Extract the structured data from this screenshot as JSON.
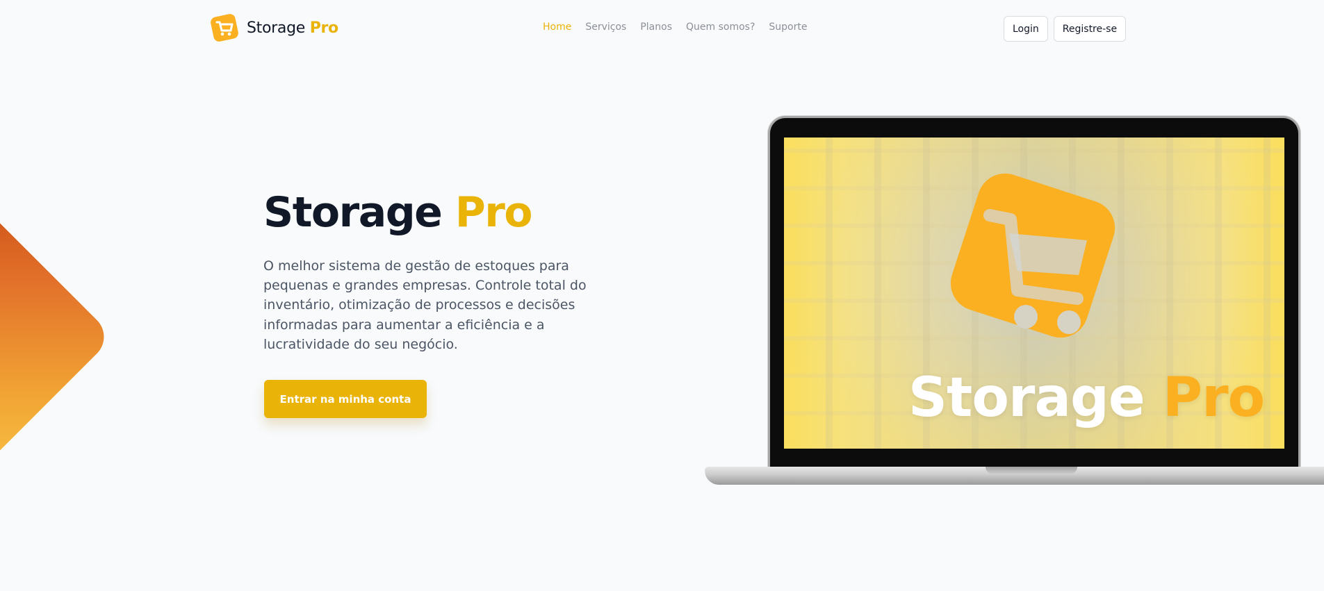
{
  "header": {
    "logo": {
      "name": "Storage",
      "accent": "Pro"
    },
    "nav": [
      {
        "label": "Home",
        "active": true
      },
      {
        "label": "Serviços",
        "active": false
      },
      {
        "label": "Planos",
        "active": false
      },
      {
        "label": "Quem somos?",
        "active": false
      },
      {
        "label": "Suporte",
        "active": false
      }
    ],
    "auth": {
      "login_label": "Login",
      "register_label": "Registre-se"
    }
  },
  "hero": {
    "title_main": "Storage",
    "title_accent": "Pro",
    "description": "O melhor sistema de gestão de estoques para pequenas e grandes empresas. Controle total do inventário, otimização de processos e decisões informadas para aumentar a eficiência e a lucratividade do seu negócio.",
    "cta_label": "Entrar na minha conta"
  },
  "laptop_screen": {
    "title_main": "Storage",
    "title_accent": "Pro"
  },
  "icons": {
    "logo": "shopping-cart-icon",
    "screen_logo": "shopping-cart-icon"
  },
  "colors": {
    "accent": "#eab308",
    "logo_orange": "#fbb022",
    "text_dark": "#111827",
    "text_muted": "#4b5563",
    "nav_muted": "#8b8f97",
    "background": "#f8fafc"
  }
}
